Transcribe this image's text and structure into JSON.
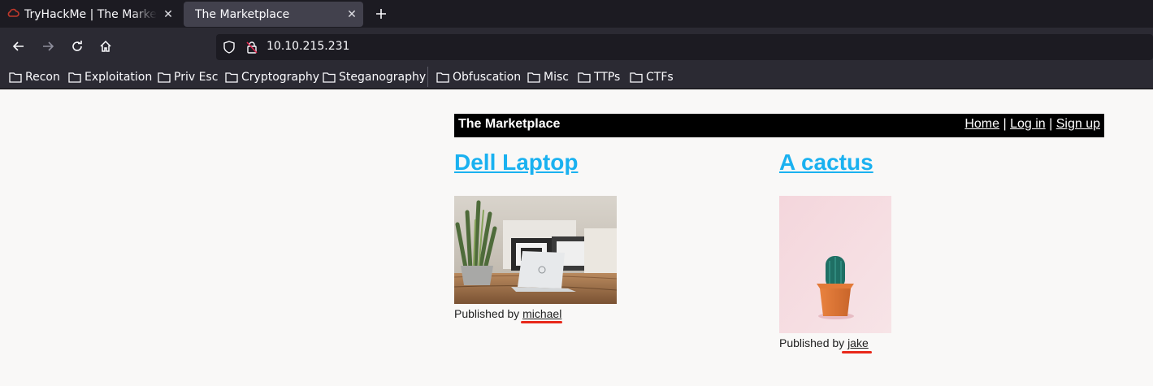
{
  "browser": {
    "tabs": [
      {
        "title": "TryHackMe | The Marketplace",
        "active": false,
        "icon": "tryhackme-cloud-icon"
      },
      {
        "title": "The Marketplace",
        "active": true
      }
    ],
    "close_glyph": "✕",
    "url": "10.10.215.231",
    "bookmarks": [
      "Recon",
      "Exploitation",
      "Priv Esc",
      "Cryptography",
      "Steganography",
      "Obfuscation",
      "Misc",
      "TTPs",
      "CTFs"
    ]
  },
  "site": {
    "title": "The Marketplace",
    "nav": {
      "home": "Home",
      "sep1": "|",
      "login": "Log in",
      "sep2": "|",
      "signup": "Sign up"
    }
  },
  "listings": [
    {
      "title": "Dell Laptop",
      "image": "laptop-photo",
      "published_prefix": "Published by",
      "author": "michael"
    },
    {
      "title": "A cactus",
      "image": "cactus-photo",
      "published_prefix": "Published by",
      "author": "jake"
    }
  ],
  "colors": {
    "link": "#1ab1f0",
    "header_bg": "#000000",
    "highlight": "#e8281a",
    "chrome_bg": "#2b2a33",
    "tabbar_bg": "#1c1b22"
  }
}
